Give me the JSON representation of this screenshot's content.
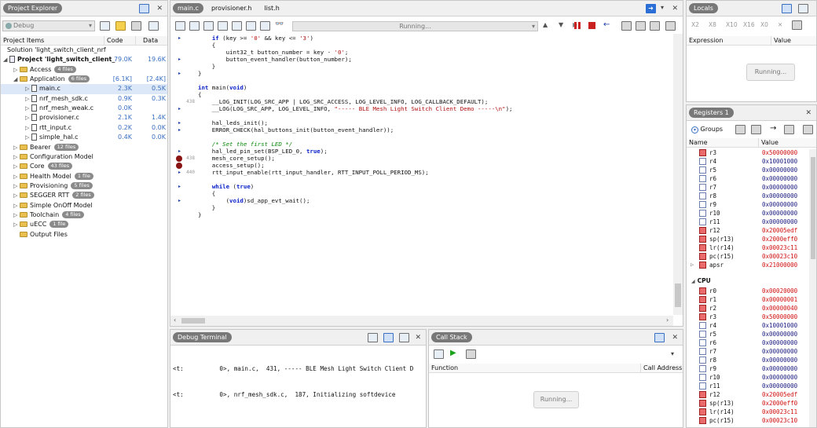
{
  "project_explorer": {
    "title": "Project Explorer",
    "config": "Debug",
    "columns": [
      "Project Items",
      "Code",
      "Data"
    ],
    "items": [
      {
        "name": "Solution 'light_switch_client_nrf",
        "code": "",
        "data": "",
        "depth": 0,
        "kind": "solution",
        "twisty": ""
      },
      {
        "name": "Project 'light_switch_client_",
        "code": "79.0K",
        "data": "19.6K",
        "depth": 0,
        "kind": "project",
        "twisty": "◢"
      },
      {
        "name": "Access",
        "badge": "4 files",
        "code": "",
        "data": "",
        "depth": 1,
        "kind": "folder",
        "twisty": "▷"
      },
      {
        "name": "Application",
        "badge": "6 files",
        "code": "[6.1K]",
        "data": "[2.4K]",
        "depth": 1,
        "kind": "folder",
        "twisty": "◢"
      },
      {
        "name": "main.c",
        "code": "2.3K",
        "data": "0.5K",
        "depth": 2,
        "kind": "file",
        "twisty": "▷",
        "selected": true
      },
      {
        "name": "nrf_mesh_sdk.c",
        "code": "0.9K",
        "data": "0.3K",
        "depth": 2,
        "kind": "file",
        "twisty": "▷"
      },
      {
        "name": "nrf_mesh_weak.c",
        "code": "0.0K",
        "data": "",
        "depth": 2,
        "kind": "file",
        "twisty": "▷"
      },
      {
        "name": "provisioner.c",
        "code": "2.1K",
        "data": "1.4K",
        "depth": 2,
        "kind": "file",
        "twisty": "▷"
      },
      {
        "name": "rtt_input.c",
        "code": "0.2K",
        "data": "0.0K",
        "depth": 2,
        "kind": "file",
        "twisty": "▷"
      },
      {
        "name": "simple_hal.c",
        "code": "0.4K",
        "data": "0.0K",
        "depth": 2,
        "kind": "file",
        "twisty": "▷"
      },
      {
        "name": "Bearer",
        "badge": "12 files",
        "code": "",
        "data": "",
        "depth": 1,
        "kind": "folder",
        "twisty": "▷"
      },
      {
        "name": "Configuration Model",
        "code": "",
        "data": "",
        "depth": 1,
        "kind": "folder",
        "twisty": "▷"
      },
      {
        "name": "Core",
        "badge": "43 files",
        "code": "",
        "data": "",
        "depth": 1,
        "kind": "folder",
        "twisty": "▷"
      },
      {
        "name": "Health Model",
        "badge": "1 file",
        "code": "",
        "data": "",
        "depth": 1,
        "kind": "folder",
        "twisty": "▷"
      },
      {
        "name": "Provisioning",
        "badge": "5 files",
        "code": "",
        "data": "",
        "depth": 1,
        "kind": "folder",
        "twisty": "▷"
      },
      {
        "name": "SEGGER RTT",
        "badge": "2 files",
        "code": "",
        "data": "",
        "depth": 1,
        "kind": "folder",
        "twisty": "▷"
      },
      {
        "name": "Simple OnOff Model",
        "code": "",
        "data": "",
        "depth": 1,
        "kind": "folder",
        "twisty": "▷"
      },
      {
        "name": "Toolchain",
        "badge": "4 files",
        "code": "",
        "data": "",
        "depth": 1,
        "kind": "folder",
        "twisty": "▷"
      },
      {
        "name": "uECC",
        "badge": "1 file",
        "code": "",
        "data": "",
        "depth": 1,
        "kind": "folder",
        "twisty": "▷"
      },
      {
        "name": "Output Files",
        "code": "",
        "data": "",
        "depth": 1,
        "kind": "folder",
        "twisty": ""
      }
    ]
  },
  "editor": {
    "tabs": [
      "main.c",
      "provisioner.h",
      "list.h"
    ],
    "status": "Running...",
    "lines": [
      {
        "html": "    <span class=\"kw\">if</span> (key &gt;= <span class=\"st\">'0'</span> &amp;&amp; key &lt;= <span class=\"st\">'3'</span>)",
        "arrow": true
      },
      {
        "html": "    {"
      },
      {
        "html": "        uint32_t button_number = key - <span class=\"st\">'0'</span>;"
      },
      {
        "html": "        button_event_handler(button_number);",
        "arrow": true
      },
      {
        "html": "    }"
      },
      {
        "html": "}",
        "arrow": true
      },
      {
        "html": ""
      },
      {
        "html": "<span class=\"kw\">int</span> main(<span class=\"kw\">void</span>)"
      },
      {
        "html": "{"
      },
      {
        "html": "    __LOG_INIT(LOG_SRC_APP | LOG_SRC_ACCESS, LOG_LEVEL_INFO, LOG_CALLBACK_DEFAULT);",
        "lnum": "438"
      },
      {
        "html": "    __LOG(LOG_SRC_APP, LOG_LEVEL_INFO, <span class=\"st\">\"----- BLE Mesh Light Switch Client Demo -----\\n\"</span>);",
        "arrow": true
      },
      {
        "html": ""
      },
      {
        "html": "    hal_leds_init();",
        "arrow": true
      },
      {
        "html": "    ERROR_CHECK(hal_buttons_init(button_event_handler));",
        "arrow": true
      },
      {
        "html": ""
      },
      {
        "html": "    <span class=\"cm\">/* Set the first LED */</span>"
      },
      {
        "html": "    hal_led_pin_set(BSP_LED_0, <span class=\"kw\">true</span>);",
        "arrow": true
      },
      {
        "html": "    mesh_core_setup();",
        "bp": true,
        "lnum": "438"
      },
      {
        "html": "    access_setup();",
        "bp": true
      },
      {
        "html": "    rtt_input_enable(rtt_input_handler, RTT_INPUT_POLL_PERIOD_MS);",
        "lnum": "440",
        "arrow": true
      },
      {
        "html": ""
      },
      {
        "html": "    <span class=\"kw\">while</span> (<span class=\"kw\">true</span>)",
        "arrow": true
      },
      {
        "html": "    {"
      },
      {
        "html": "        (<span class=\"kw\">void</span>)sd_app_evt_wait();",
        "arrow": true
      },
      {
        "html": "    }"
      },
      {
        "html": "}"
      }
    ]
  },
  "debug_terminal": {
    "title": "Debug Terminal",
    "lines": [
      "<t:          0>, main.c,  431, ----- BLE Mesh Light Switch Client D",
      "<t:          0>, nrf_mesh_sdk.c,  187, Initializing softdevice"
    ]
  },
  "call_stack": {
    "title": "Call Stack",
    "columns": [
      "Function",
      "Call Address"
    ],
    "status": "Running..."
  },
  "locals": {
    "title": "Locals",
    "columns": [
      "Expression",
      "Value"
    ],
    "status": "Running...",
    "format_labels": [
      "X2",
      "X8",
      "X10",
      "X16",
      "X0",
      "✕"
    ]
  },
  "registers": {
    "title": "Registers 1",
    "groups_label": "Groups",
    "columns": [
      "Name",
      "Value"
    ],
    "cpu_label": "CPU",
    "set1": [
      {
        "name": "r3",
        "value": "0x50000000",
        "changed": true
      },
      {
        "name": "r4",
        "value": "0x10001000",
        "changed": false
      },
      {
        "name": "r5",
        "value": "0x00000000",
        "changed": false
      },
      {
        "name": "r6",
        "value": "0x00000000",
        "changed": false
      },
      {
        "name": "r7",
        "value": "0x00000000",
        "changed": false
      },
      {
        "name": "r8",
        "value": "0x00000000",
        "changed": false
      },
      {
        "name": "r9",
        "value": "0x00000000",
        "changed": false
      },
      {
        "name": "r10",
        "value": "0x00000000",
        "changed": false
      },
      {
        "name": "r11",
        "value": "0x00000000",
        "changed": false
      },
      {
        "name": "r12",
        "value": "0x20005edf",
        "changed": true
      },
      {
        "name": "sp(r13)",
        "value": "0x2000eff0",
        "changed": true
      },
      {
        "name": "lr(r14)",
        "value": "0x00023c11",
        "changed": true
      },
      {
        "name": "pc(r15)",
        "value": "0x00023c10",
        "changed": true
      },
      {
        "name": "apsr",
        "value": "0x21000000",
        "changed": true,
        "twisty": "▷"
      }
    ],
    "cpu": [
      {
        "name": "r0",
        "value": "0x00020000",
        "changed": true
      },
      {
        "name": "r1",
        "value": "0x00000001",
        "changed": true
      },
      {
        "name": "r2",
        "value": "0x00000040",
        "changed": true
      },
      {
        "name": "r3",
        "value": "0x50000000",
        "changed": true
      },
      {
        "name": "r4",
        "value": "0x10001000",
        "changed": false
      },
      {
        "name": "r5",
        "value": "0x00000000",
        "changed": false
      },
      {
        "name": "r6",
        "value": "0x00000000",
        "changed": false
      },
      {
        "name": "r7",
        "value": "0x00000000",
        "changed": false
      },
      {
        "name": "r8",
        "value": "0x00000000",
        "changed": false
      },
      {
        "name": "r9",
        "value": "0x00000000",
        "changed": false
      },
      {
        "name": "r10",
        "value": "0x00000000",
        "changed": false
      },
      {
        "name": "r11",
        "value": "0x00000000",
        "changed": false
      },
      {
        "name": "r12",
        "value": "0x20005edf",
        "changed": true
      },
      {
        "name": "sp(r13)",
        "value": "0x2000eff0",
        "changed": true
      },
      {
        "name": "lr(r14)",
        "value": "0x00023c11",
        "changed": true
      },
      {
        "name": "pc(r15)",
        "value": "0x00023c10",
        "changed": true
      }
    ]
  },
  "colors": {
    "accent": "#3a6fc2",
    "changed_value": "#d01010",
    "normal_value": "#1a1a80",
    "breakpoint": "#8a1414"
  }
}
